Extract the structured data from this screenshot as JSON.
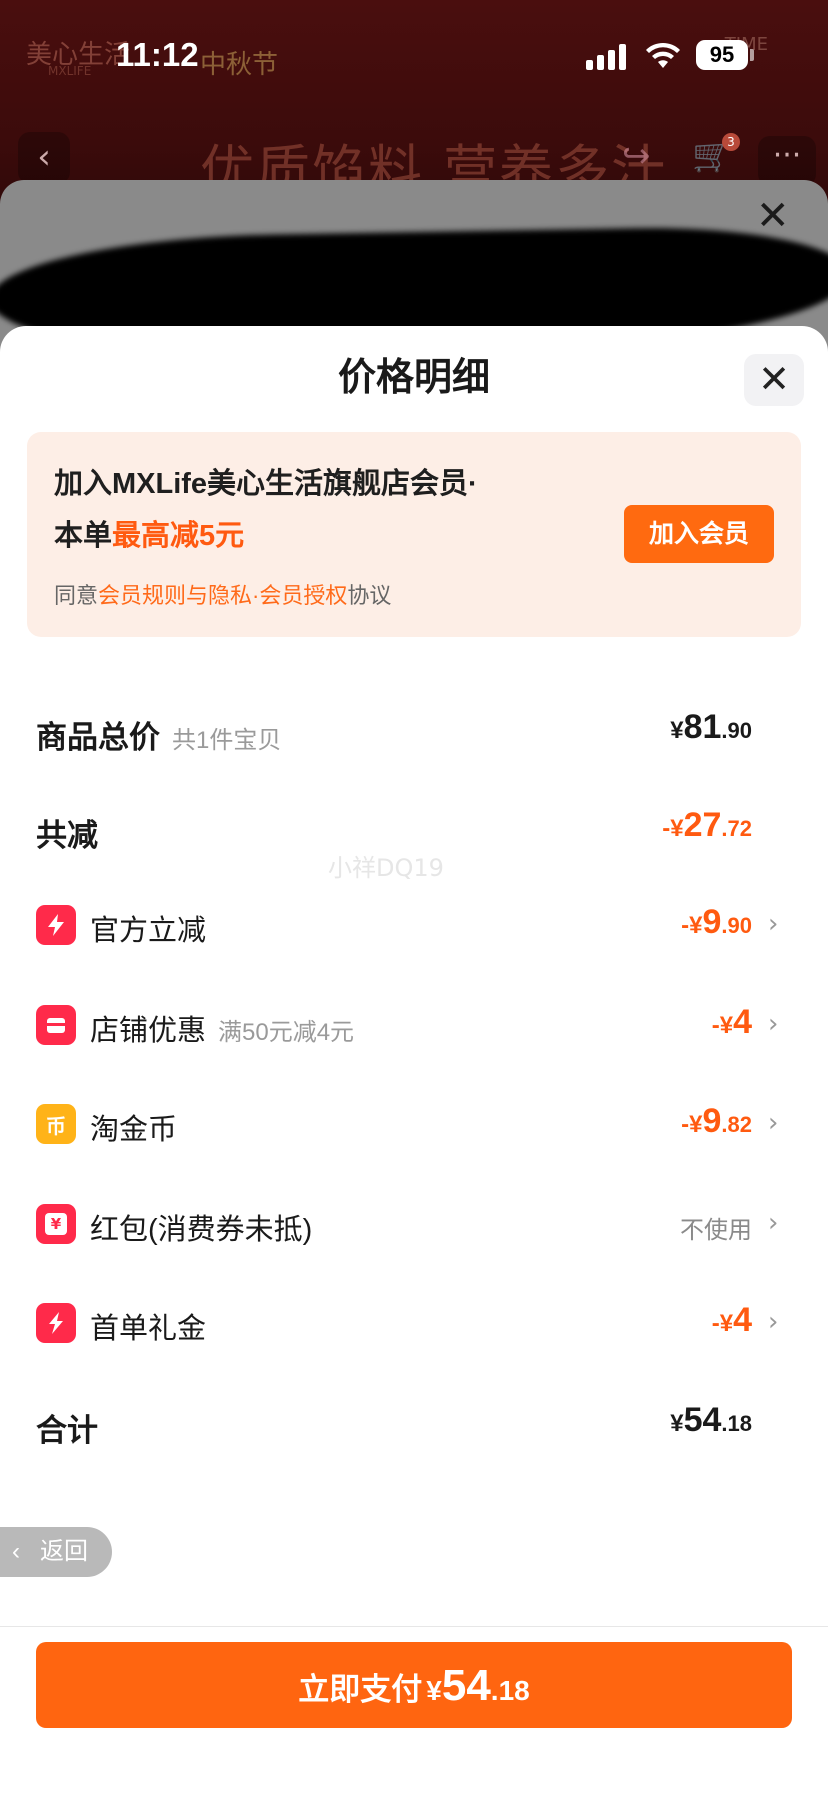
{
  "status_bar": {
    "time": "11:12",
    "battery": "95"
  },
  "background": {
    "brand": "美心生活",
    "brand_sub": "MXLIFE",
    "festival": "中秋节",
    "time_label": "TIME",
    "headline": "优质馅料 营养多汁",
    "cart_badge": "3"
  },
  "sheet": {
    "title": "价格明细",
    "membership": {
      "line1": "加入MXLife美心生活旗舰店会员·",
      "line2_prefix": "本单",
      "line2_highlight": "最高减5元",
      "agree_prefix": "同意",
      "agree_link": "会员规则与隐私·会员授权",
      "agree_suffix": "协议",
      "join_button": "加入会员"
    },
    "rows": {
      "total": {
        "label": "商品总价",
        "sub": "共1件宝贝",
        "yen": "¥",
        "int": "81",
        "dec": ".90"
      },
      "discount_total": {
        "label": "共减",
        "prefix": "-¥",
        "int": "27",
        "dec": ".72"
      },
      "official": {
        "label": "官方立减",
        "prefix": "-¥",
        "int": "9",
        "dec": ".90"
      },
      "store": {
        "label": "店铺优惠",
        "sub": "满50元减4元",
        "prefix": "-¥",
        "int": "4"
      },
      "coins": {
        "label": "淘金币",
        "prefix": "-¥",
        "int": "9",
        "dec": ".82",
        "icon_char": "币"
      },
      "redpacket": {
        "label": "红包(消费券未抵)",
        "value": "不使用",
        "icon_char": "¥"
      },
      "firstorder": {
        "label": "首单礼金",
        "prefix": "-¥",
        "int": "4"
      },
      "sum": {
        "label": "合计",
        "yen": "¥",
        "int": "54",
        "dec": ".18"
      }
    },
    "back_button": "返回",
    "pay_button": {
      "label": "立即支付",
      "yen": "¥",
      "int": "54",
      "dec": ".18"
    },
    "watermark": "小祥DQ19"
  },
  "colors": {
    "accent": "#ff6510",
    "red_icon": "#ff2a4a",
    "yellow_icon": "#ffb318",
    "member_bg": "#fdeee6"
  }
}
